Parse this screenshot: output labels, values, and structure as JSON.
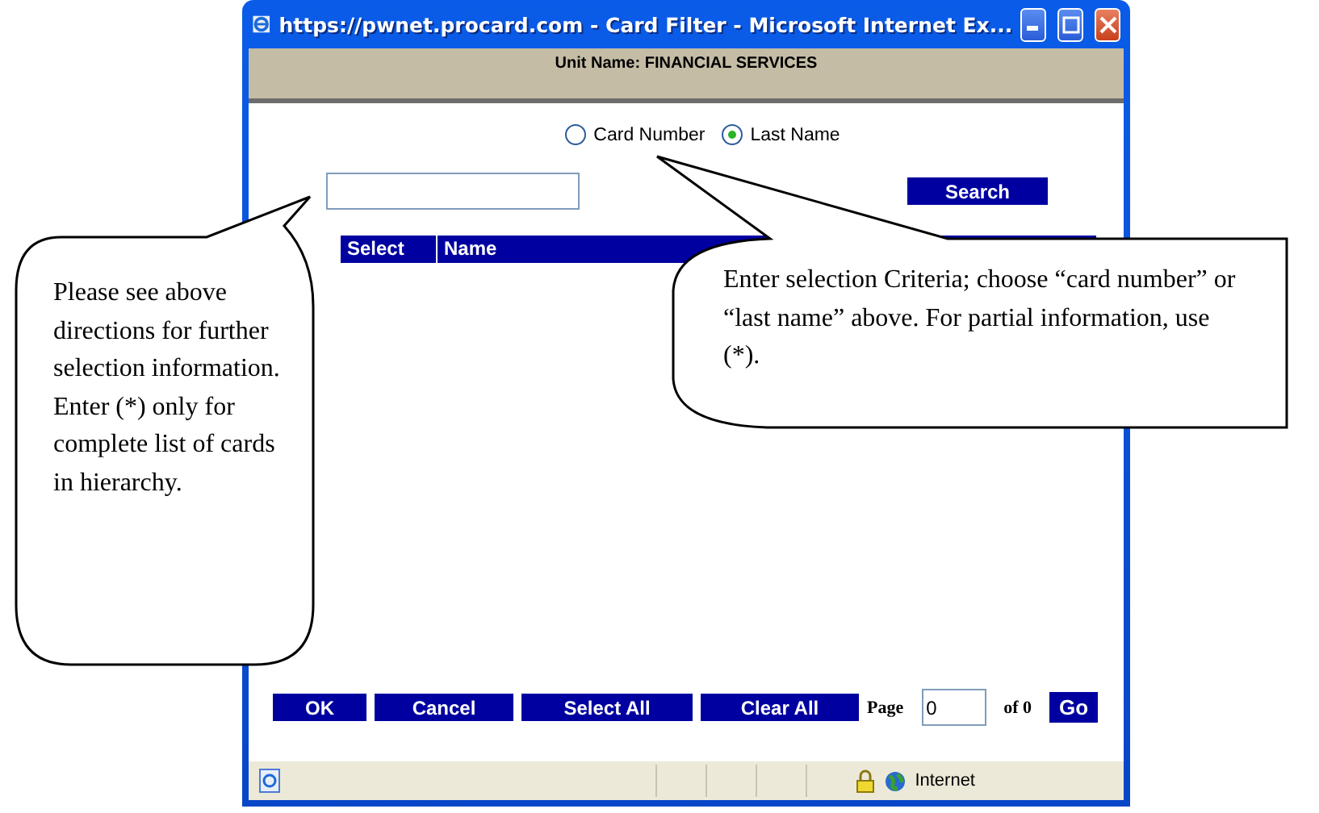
{
  "window": {
    "title": "https://pwnet.procard.com - Card Filter - Microsoft Internet Ex..."
  },
  "header": {
    "unit_name": "Unit Name: FINANCIAL SERVICES"
  },
  "search_by": [
    {
      "label": "Card Number",
      "selected": false
    },
    {
      "label": "Last Name",
      "selected": true
    }
  ],
  "search_button": "Search",
  "table": {
    "columns": [
      "Select",
      "Name"
    ]
  },
  "buttons": [
    "OK",
    "Cancel",
    "Select All",
    "Clear All"
  ],
  "pager": {
    "label": "Page",
    "value": "0",
    "of": "of 0",
    "button": "Go"
  },
  "status_bar": {
    "zone": "Internet"
  },
  "callouts": [
    {
      "text": "Please see above directions for further selection information. Enter (*) only for complete list of cards in hierarchy."
    },
    {
      "text": "Enter selection Criteria; choose “card number” or “last name” above. For partial information, use (*)."
    }
  ]
}
